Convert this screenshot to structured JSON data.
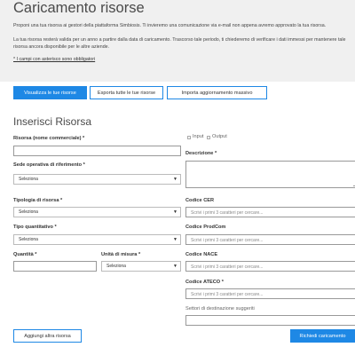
{
  "header": {
    "title": "Caricamento risorse",
    "intro": "Proponi una tua risorsa ai gestori della piattaforma Simbiosis. Ti invieremo una comunicazione via e-mail non appena avremo approvato la tua risorsa.",
    "note": "La tua risorsa resterà valida per un anno a partire dalla data di caricamento. Trascorso tale periodo, ti chiederemo di verificare i dati immessi per mantenere tale risorsa ancora disponibile per le altre aziende.",
    "required_note": "* I campi con asterisco sono obbligatori"
  },
  "actions": {
    "view": "Visualizza le tue risorse",
    "export": "Esporta tutte le tue risorse",
    "import": "Importa aggiornamento massivo"
  },
  "form": {
    "title": "Inserisci Risorsa",
    "name_label": "Risorsa (nome commerciale) *",
    "name_value": "",
    "site_label": "Sede operativa di riferimento *",
    "site_value": "Seleziona",
    "type_label": "Tipologia di risorsa *",
    "type_value": "Seleziona",
    "qtype_label": "Tipo quantitativo *",
    "qtype_value": "Seleziona",
    "qty_label": "Quantità *",
    "qty_value": "",
    "unit_label": "Unità di misura *",
    "unit_value": "Seleziona",
    "input_label": "Input",
    "output_label": "Output",
    "desc_label": "Descrizione *",
    "desc_value": "",
    "cer_label": "Codice CER",
    "cer_placeholder": "Scrivi i primi 3 caratteri per cercare...",
    "prodcom_label": "Codice ProdCom",
    "prodcom_placeholder": "Scrivi i primi 3 caratteri per cercare...",
    "nace_label": "Codice NACE",
    "nace_placeholder": "Scrivi i primi 3 caratteri per cercare...",
    "ateco_label": "Codice ATECO *",
    "ateco_placeholder": "Scrivi i primi 3 caratteri per cercare...",
    "sectors_label": "Settori di destinazione suggeriti",
    "sectors_value": ""
  },
  "footer": {
    "add_label": "Aggiungi altra risorsa",
    "submit_label": "Richiedi caricamento"
  },
  "colors": {
    "accent": "#1e88e5",
    "header_bg": "#f0f0f0"
  }
}
